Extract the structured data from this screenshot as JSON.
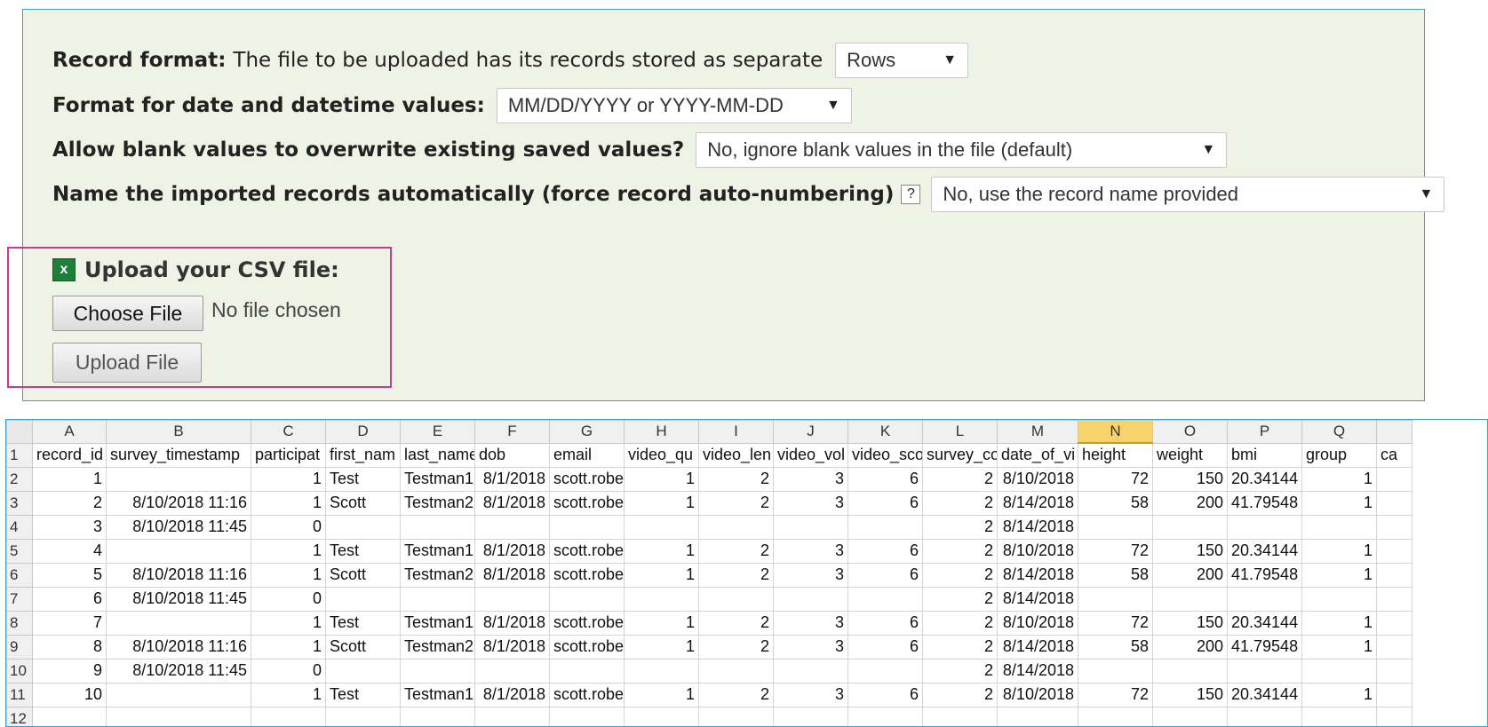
{
  "form": {
    "record_format_label": "Record format:",
    "record_format_text": "The file to be uploaded has its records stored as separate",
    "record_format_value": "Rows",
    "date_format_label": "Format for date and datetime values:",
    "date_format_value": "MM/DD/YYYY or YYYY-MM-DD",
    "blank_label": "Allow blank values to overwrite existing saved values?",
    "blank_value": "No, ignore blank values in the file (default)",
    "autonumber_label": "Name the imported records automatically (force record auto-numbering)",
    "help_glyph": "?",
    "autonumber_value": "No, use the record name provided",
    "dropdown_arrow": "▼"
  },
  "upload": {
    "title": "Upload your CSV file:",
    "excel_icon_glyph": "x",
    "choose_label": "Choose File",
    "no_file": "No file chosen",
    "upload_label": "Upload File"
  },
  "sheet": {
    "columns": [
      "A",
      "B",
      "C",
      "D",
      "E",
      "F",
      "G",
      "H",
      "I",
      "J",
      "K",
      "L",
      "M",
      "N",
      "O",
      "P",
      "Q",
      ""
    ],
    "selected_column": "N",
    "header_row": [
      "record_id",
      "survey_timestamp",
      "participat",
      "first_nam",
      "last_name",
      "dob",
      "email",
      "video_qu",
      "video_len",
      "video_vol",
      "video_sco",
      "survey_co",
      "date_of_vi",
      "height",
      "weight",
      "bmi",
      "group",
      "ca"
    ],
    "rows": [
      [
        "1",
        "",
        "1",
        "Test",
        "Testman1",
        "8/1/2018",
        "scott.robe",
        "1",
        "2",
        "3",
        "6",
        "2",
        "8/10/2018",
        "72",
        "150",
        "20.34144",
        "1",
        ""
      ],
      [
        "2",
        "8/10/2018 11:16",
        "1",
        "Scott",
        "Testman2",
        "8/1/2018",
        "scott.robe",
        "1",
        "2",
        "3",
        "6",
        "2",
        "8/14/2018",
        "58",
        "200",
        "41.79548",
        "1",
        ""
      ],
      [
        "3",
        "8/10/2018 11:45",
        "0",
        "",
        "",
        "",
        "",
        "",
        "",
        "",
        "",
        "2",
        "8/14/2018",
        "",
        "",
        "",
        "",
        ""
      ],
      [
        "4",
        "",
        "1",
        "Test",
        "Testman1",
        "8/1/2018",
        "scott.robe",
        "1",
        "2",
        "3",
        "6",
        "2",
        "8/10/2018",
        "72",
        "150",
        "20.34144",
        "1",
        ""
      ],
      [
        "5",
        "8/10/2018 11:16",
        "1",
        "Scott",
        "Testman2",
        "8/1/2018",
        "scott.robe",
        "1",
        "2",
        "3",
        "6",
        "2",
        "8/14/2018",
        "58",
        "200",
        "41.79548",
        "1",
        ""
      ],
      [
        "6",
        "8/10/2018 11:45",
        "0",
        "",
        "",
        "",
        "",
        "",
        "",
        "",
        "",
        "2",
        "8/14/2018",
        "",
        "",
        "",
        "",
        ""
      ],
      [
        "7",
        "",
        "1",
        "Test",
        "Testman1",
        "8/1/2018",
        "scott.robe",
        "1",
        "2",
        "3",
        "6",
        "2",
        "8/10/2018",
        "72",
        "150",
        "20.34144",
        "1",
        ""
      ],
      [
        "8",
        "8/10/2018 11:16",
        "1",
        "Scott",
        "Testman2",
        "8/1/2018",
        "scott.robe",
        "1",
        "2",
        "3",
        "6",
        "2",
        "8/14/2018",
        "58",
        "200",
        "41.79548",
        "1",
        ""
      ],
      [
        "9",
        "8/10/2018 11:45",
        "0",
        "",
        "",
        "",
        "",
        "",
        "",
        "",
        "",
        "2",
        "8/14/2018",
        "",
        "",
        "",
        "",
        ""
      ],
      [
        "10",
        "",
        "1",
        "Test",
        "Testman1",
        "8/1/2018",
        "scott.robe",
        "1",
        "2",
        "3",
        "6",
        "2",
        "8/10/2018",
        "72",
        "150",
        "20.34144",
        "1",
        ""
      ],
      [
        "",
        "",
        "",
        "",
        "",
        "",
        "",
        "",
        "",
        "",
        "",
        "",
        "",
        "",
        "",
        "",
        "",
        ""
      ]
    ],
    "row_numbers": [
      "1",
      "2",
      "3",
      "4",
      "5",
      "6",
      "7",
      "8",
      "9",
      "10",
      "11",
      "12"
    ]
  }
}
